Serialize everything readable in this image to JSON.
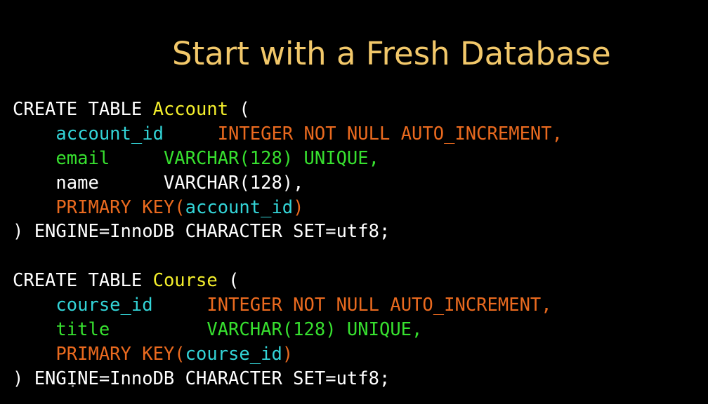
{
  "slide": {
    "title": "Start with a Fresh Database"
  },
  "code": {
    "lines": [
      [
        {
          "text": "CREATE TABLE ",
          "color": "white"
        },
        {
          "text": "Account",
          "color": "yellow"
        },
        {
          "text": " (",
          "color": "white"
        }
      ],
      [
        {
          "text": "    account_id",
          "color": "cyan"
        },
        {
          "text": "     ",
          "color": "white"
        },
        {
          "text": "INTEGER NOT NULL AUTO_INCREMENT,",
          "color": "orange"
        }
      ],
      [
        {
          "text": "    email",
          "color": "green"
        },
        {
          "text": "     ",
          "color": "white"
        },
        {
          "text": "VARCHAR(128) UNIQUE,",
          "color": "green"
        }
      ],
      [
        {
          "text": "    name      VARCHAR(128),",
          "color": "white"
        }
      ],
      [
        {
          "text": "    PRIMARY KEY(",
          "color": "orange"
        },
        {
          "text": "account_id",
          "color": "cyan"
        },
        {
          "text": ")",
          "color": "orange"
        }
      ],
      [
        {
          "text": ") ENGINE=InnoDB CHARACTER SET=utf8;",
          "color": "white"
        }
      ],
      [
        {
          "text": "",
          "color": "white"
        }
      ],
      [
        {
          "text": "CREATE TABLE ",
          "color": "white"
        },
        {
          "text": "Course",
          "color": "yellow"
        },
        {
          "text": " (",
          "color": "white"
        }
      ],
      [
        {
          "text": "    course_id",
          "color": "cyan"
        },
        {
          "text": "     ",
          "color": "white"
        },
        {
          "text": "INTEGER NOT NULL AUTO_INCREMENT,",
          "color": "orange"
        }
      ],
      [
        {
          "text": "    title",
          "color": "green"
        },
        {
          "text": "         ",
          "color": "white"
        },
        {
          "text": "VARCHAR(128) UNIQUE,",
          "color": "green"
        }
      ],
      [
        {
          "text": "    PRIMARY KEY(",
          "color": "orange"
        },
        {
          "text": "course_id",
          "color": "cyan"
        },
        {
          "text": ")",
          "color": "orange"
        }
      ],
      [
        {
          "text": ") ENGINE=InnoDB CHARACTER SET=utf8;",
          "color": "white"
        }
      ]
    ]
  },
  "colors": {
    "background": "#000000",
    "title": "#f2c86a",
    "white": "#ffffff",
    "yellow": "#f4ef2c",
    "cyan": "#33d4d7",
    "green": "#37e02f",
    "orange": "#ea6a1f"
  }
}
